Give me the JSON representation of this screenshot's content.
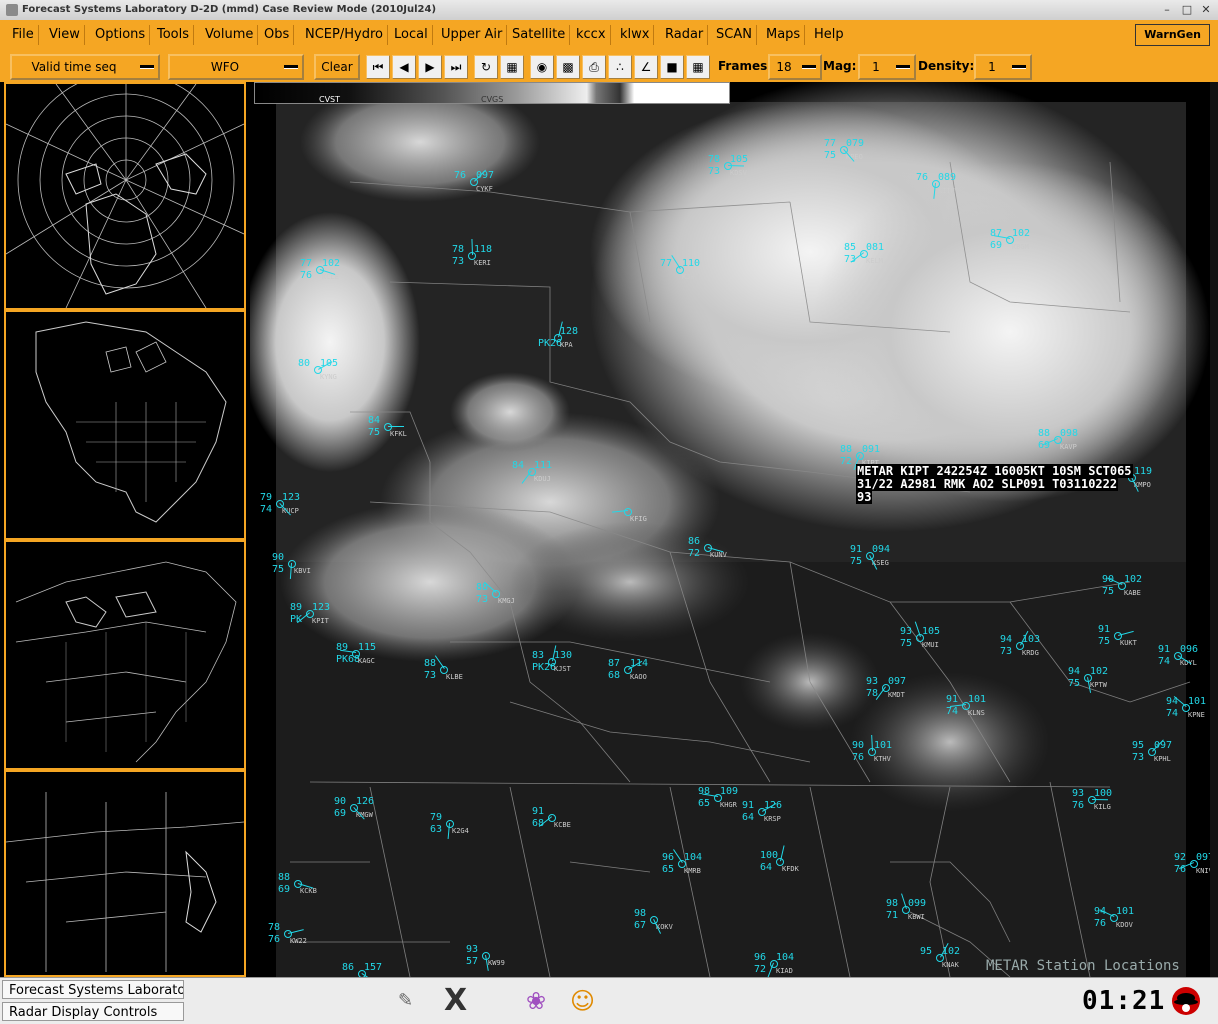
{
  "window": {
    "title": "Forecast Systems Laboratory D-2D (mmd) Case Review Mode (2010Jul24)"
  },
  "menubar": {
    "items": [
      "File",
      "View",
      "Options",
      "Tools",
      "Volume",
      "Obs",
      "NCEP/Hydro",
      "Local",
      "Upper Air",
      "Satellite",
      "kccx",
      "klwx",
      "Radar",
      "SCAN",
      "Maps",
      "Help"
    ],
    "wamgen": "WarnGen"
  },
  "toolbar": {
    "time_mode": "Valid time seq",
    "scale": "WFO",
    "clear": "Clear",
    "frames_label": "Frames:",
    "frames_value": "18",
    "mag_label": "Mag:",
    "mag_value": "1",
    "density_label": "Density:",
    "density_value": "1",
    "buttons": [
      "first-frame",
      "prev-frame",
      "next-frame",
      "last-frame",
      "loop",
      "image-combine",
      "rock",
      "swap",
      "print",
      "points",
      "baselines",
      "panel-1",
      "panel-4"
    ]
  },
  "map": {
    "colorbar_labels": [
      "CVST",
      "CVGS"
    ],
    "metar_popup": {
      "line1": "METAR KIPT 242254Z 16005KT 10SM SCT065",
      "line2": "31/22 A2981 RMK AO2 SLP091 T03110222",
      "line3": "93"
    },
    "overlay_label": "METAR Station Locations",
    "stations": [
      {
        "id": "KFKL",
        "t": "84",
        "d": "75",
        "p": ""
      },
      {
        "id": "KUCP",
        "t": "79",
        "d": "74",
        "p": "123"
      },
      {
        "id": "KBVI",
        "t": "90",
        "d": "75",
        "p": ""
      },
      {
        "id": "KPIT",
        "t": "89",
        "d": "PK",
        "p": "123"
      },
      {
        "id": "KAGC",
        "t": "89",
        "d": "PK68",
        "p": "115"
      },
      {
        "id": "KLBE",
        "t": "88",
        "d": "73",
        "p": ""
      },
      {
        "id": "KJST",
        "t": "83",
        "d": "PK26",
        "p": "130"
      },
      {
        "id": "KAOO",
        "t": "87",
        "d": "68",
        "p": "114"
      },
      {
        "id": "KUNV",
        "t": "86",
        "d": "72",
        "p": ""
      },
      {
        "id": "KSEG",
        "t": "91",
        "d": "75",
        "p": "094"
      },
      {
        "id": "KIPT",
        "t": "88",
        "d": "72",
        "p": "091"
      },
      {
        "id": "KAVP",
        "t": "88",
        "d": "69",
        "p": "098"
      },
      {
        "id": "KABE",
        "t": "90",
        "d": "75",
        "p": "102"
      },
      {
        "id": "KMUI",
        "t": "93",
        "d": "75",
        "p": "105"
      },
      {
        "id": "KRDG",
        "t": "94",
        "d": "73",
        "p": "103"
      },
      {
        "id": "KUKT",
        "t": "91",
        "d": "75",
        "p": ""
      },
      {
        "id": "KDYL",
        "t": "91",
        "d": "74",
        "p": "096"
      },
      {
        "id": "KPTW",
        "t": "94",
        "d": "75",
        "p": "102"
      },
      {
        "id": "KMDT",
        "t": "93",
        "d": "78",
        "p": "097"
      },
      {
        "id": "KLNS",
        "t": "91",
        "d": "74",
        "p": "101"
      },
      {
        "id": "KPNE",
        "t": "94",
        "d": "74",
        "p": "101"
      },
      {
        "id": "KTHV",
        "t": "90",
        "d": "76",
        "p": "101"
      },
      {
        "id": "KPHL",
        "t": "95",
        "d": "73",
        "p": "097"
      },
      {
        "id": "KILG",
        "t": "93",
        "d": "76",
        "p": "100"
      },
      {
        "id": "KMGW",
        "t": "90",
        "d": "69",
        "p": "126"
      },
      {
        "id": "K2G4",
        "t": "79",
        "d": "63",
        "p": ""
      },
      {
        "id": "KCBE",
        "t": "91",
        "d": "68",
        "p": ""
      },
      {
        "id": "KHGR",
        "t": "98",
        "d": "65",
        "p": "109"
      },
      {
        "id": "KMRB",
        "t": "96",
        "d": "65",
        "p": "104"
      },
      {
        "id": "KFDK",
        "t": "100",
        "d": "64",
        "p": ""
      },
      {
        "id": "KRSP",
        "t": "91",
        "d": "64",
        "p": "126"
      },
      {
        "id": "KCKB",
        "t": "88",
        "d": "69",
        "p": ""
      },
      {
        "id": "KOKV",
        "t": "98",
        "d": "67",
        "p": ""
      },
      {
        "id": "KIAD",
        "t": "96",
        "d": "72",
        "p": "104"
      },
      {
        "id": "KNIV",
        "t": "92",
        "d": "76",
        "p": "097"
      },
      {
        "id": "KDOV",
        "t": "94",
        "d": "76",
        "p": "101"
      },
      {
        "id": "KBWI",
        "t": "98",
        "d": "71",
        "p": "099"
      },
      {
        "id": "KNAK",
        "t": "95",
        "d": "",
        "p": "102"
      },
      {
        "id": "KW22",
        "t": "78",
        "d": "76",
        "p": ""
      },
      {
        "id": "KEKN",
        "t": "86",
        "d": "",
        "p": "157"
      },
      {
        "id": "KW99",
        "t": "93",
        "d": "57",
        "p": ""
      },
      {
        "id": "KDUJ",
        "t": "84",
        "d": "",
        "p": "111"
      },
      {
        "id": "KFIG",
        "t": "",
        "d": "",
        "p": ""
      },
      {
        "id": "KMGJ",
        "t": "88",
        "d": "73",
        "p": ""
      },
      {
        "id": "KERI",
        "t": "78",
        "d": "73",
        "p": "118"
      },
      {
        "id": "CYKF",
        "t": "76",
        "d": "",
        "p": "097"
      },
      {
        "id": "KDSV",
        "t": "78",
        "d": "73",
        "p": "105"
      },
      {
        "id": "KPEO",
        "t": "77",
        "d": "75",
        "p": "079"
      },
      {
        "id": "KITH",
        "t": "76",
        "d": "",
        "p": "089"
      },
      {
        "id": "KELM",
        "t": "85",
        "d": "73",
        "p": "081"
      },
      {
        "id": "KBGM",
        "t": "87",
        "d": "69",
        "p": "102"
      },
      {
        "id": "KJHW",
        "t": "77",
        "d": "",
        "p": "110"
      },
      {
        "id": "KPA",
        "t": "",
        "d": "PK26",
        "p": "128"
      },
      {
        "id": "KYNG",
        "t": "80",
        "d": "",
        "p": "105"
      },
      {
        "id": "KCLE",
        "t": "77",
        "d": "76",
        "p": "102"
      },
      {
        "id": "KMPO",
        "t": "",
        "d": "",
        "p": "119"
      }
    ]
  },
  "taskbar": {
    "tasks": [
      "Forecast Systems Laborato",
      "Radar Display Controls"
    ],
    "clock": "01:21"
  }
}
